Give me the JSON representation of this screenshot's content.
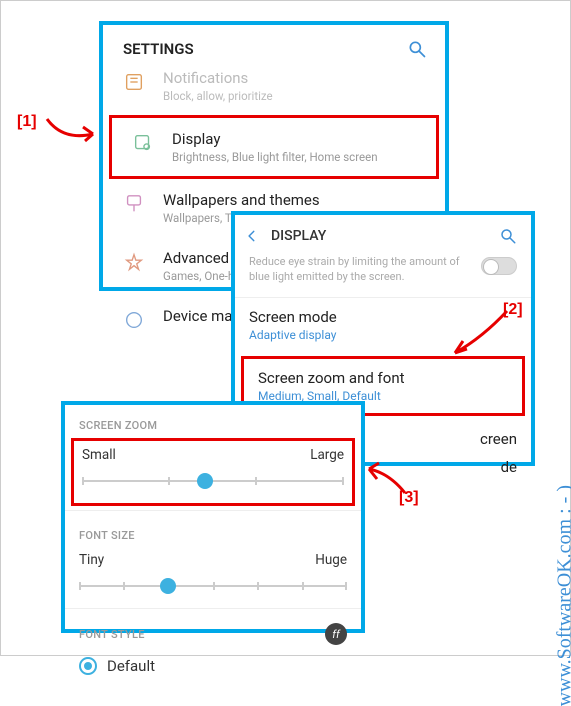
{
  "p1": {
    "header": "SETTINGS",
    "items": [
      {
        "title": "Notifications",
        "sub": "Block, allow, prioritize"
      },
      {
        "title": "Display",
        "sub": "Brightness, Blue light filter, Home screen"
      },
      {
        "title": "Wallpapers and themes",
        "sub": "Wallpapers, Themes, Icons"
      },
      {
        "title": "Advanced features",
        "sub": "Games, One-handed mode"
      },
      {
        "title": "Device maintenance",
        "sub": ""
      }
    ]
  },
  "p2": {
    "header": "DISPLAY",
    "bluelight_desc": "Reduce eye strain by limiting the amount of blue light emitted by the screen.",
    "screen_mode": {
      "title": "Screen mode",
      "sub": "Adaptive display"
    },
    "zoom_font": {
      "title": "Screen zoom and font",
      "sub": "Medium, Small, Default"
    },
    "extra1": "creen",
    "extra2": "de"
  },
  "p3": {
    "sec_zoom": "SCREEN ZOOM",
    "zoom_min": "Small",
    "zoom_max": "Large",
    "sec_font_size": "FONT SIZE",
    "fs_min": "Tiny",
    "fs_max": "Huge",
    "sec_font_style": "FONT STYLE",
    "ff_badge": "ff",
    "font_default": "Default"
  },
  "anno": {
    "a1": "[1]",
    "a2": "[2]",
    "a3": "[3]"
  },
  "watermark": "www.SoftwareOK.com  : - )"
}
